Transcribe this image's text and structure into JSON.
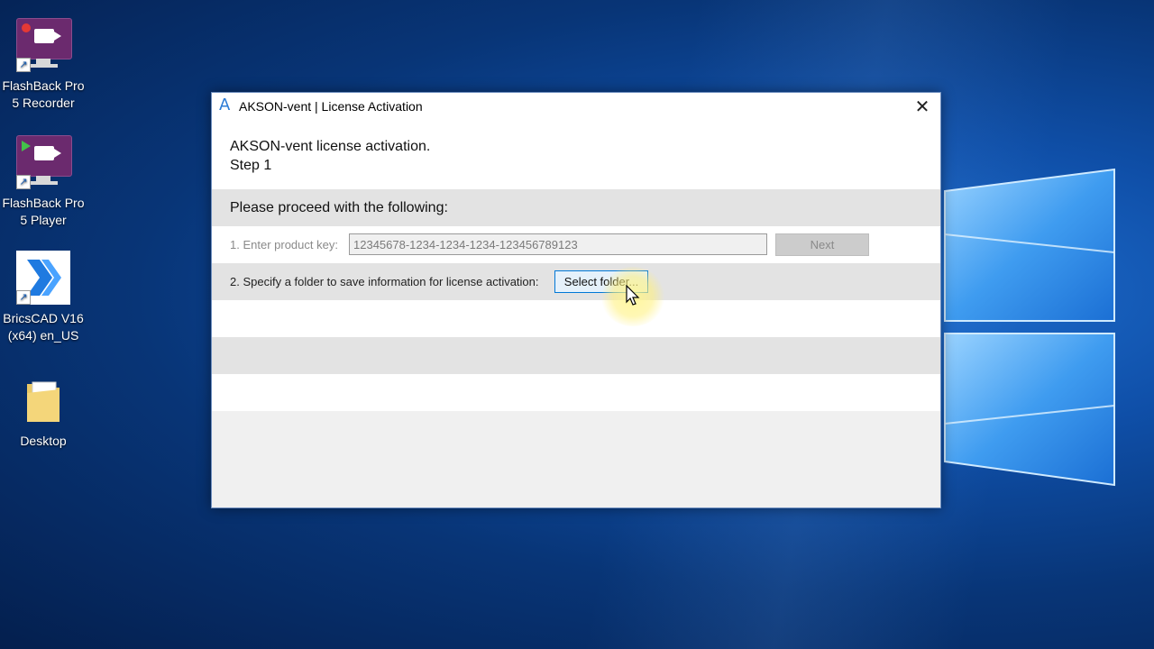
{
  "desktop": {
    "icons": [
      {
        "label_line1": "FlashBack Pro",
        "label_line2": "5 Recorder"
      },
      {
        "label_line1": "FlashBack Pro",
        "label_line2": "5 Player"
      },
      {
        "label_line1": "BricsCAD V16",
        "label_line2": "(x64) en_US"
      },
      {
        "label_line1": "Desktop",
        "label_line2": ""
      }
    ]
  },
  "dialog": {
    "title": "AKSON-vent | License Activation",
    "close_glyph": "✕",
    "app_icon_glyph": "A",
    "header_line1": "AKSON-vent license activation.",
    "header_line2": "Step 1",
    "proceed_text": "Please proceed with the following:",
    "step1": {
      "label": "1. Enter product key:",
      "key_value": "12345678-1234-1234-1234-123456789123",
      "next_label": "Next"
    },
    "step2": {
      "label": "2. Specify a folder to save information for license activation:",
      "button_label": "Select folder..."
    }
  },
  "colors": {
    "accent": "#0078d7",
    "desktop_blue": "#0f4fa8",
    "flashback_purple": "#6b2a6e"
  }
}
